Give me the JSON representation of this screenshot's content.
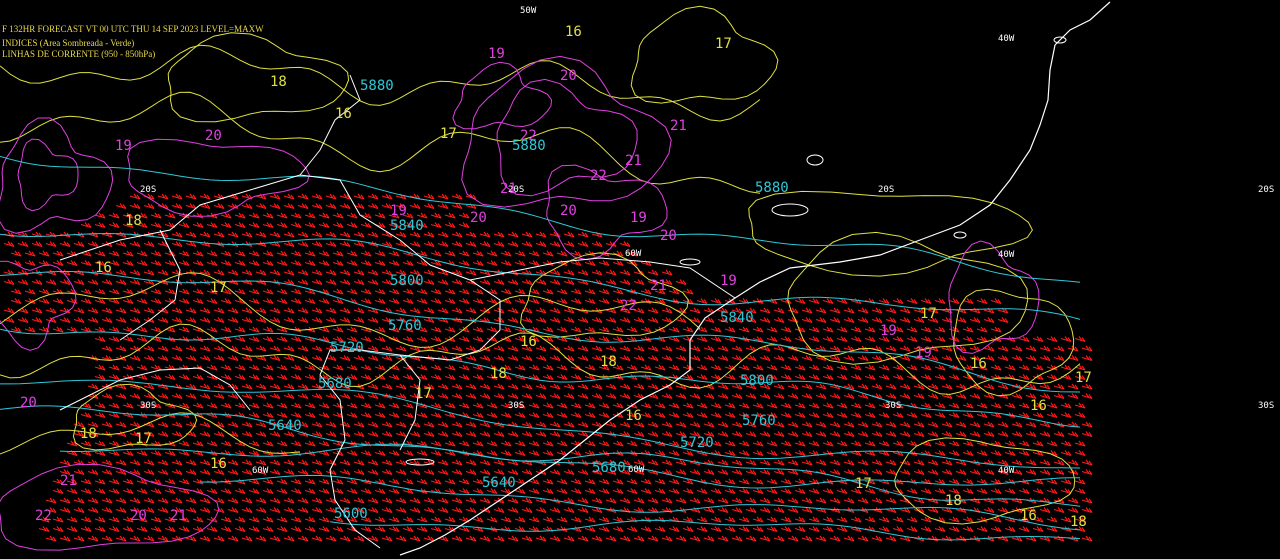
{
  "header": {
    "line1": "F 132HR FORECAST   VT 00 UTC THU 14 SEP 2023   LEVEL=MAXW",
    "line2": "INDICES (Area Sombreada - Verde)",
    "line3": "LINHAS DE CORRENTE (950 - 850hPa)"
  },
  "colors": {
    "background": "#000000",
    "wind_barbs": "#ff1a1a",
    "height_contours": "#2ec8d8",
    "index_contours_a": "#e0e040",
    "index_contours_b": "#e040e0",
    "coastline": "#ffffff",
    "grid_labels": "#ffffff"
  },
  "grid_labels": {
    "lat": [
      "20S",
      "20S",
      "20S",
      "20S",
      "30S",
      "30S",
      "30S",
      "30S"
    ],
    "lon": [
      "60W",
      "40W",
      "60W",
      "40W",
      "60W",
      "40W",
      "50W"
    ]
  },
  "height_labels": [
    "5880",
    "5880",
    "5840",
    "5800",
    "5760",
    "5720",
    "5680",
    "5640",
    "5840",
    "5800",
    "5760",
    "5720",
    "5680",
    "5640",
    "5600",
    "5880"
  ],
  "yellow_labels": [
    "16",
    "17",
    "18",
    "16",
    "17",
    "18",
    "16",
    "17",
    "16",
    "18",
    "17",
    "16",
    "18",
    "17",
    "16",
    "17",
    "18",
    "16",
    "17",
    "18",
    "16",
    "17",
    "16",
    "18"
  ],
  "magenta_labels": [
    "19",
    "20",
    "21",
    "22",
    "19",
    "20",
    "21",
    "22",
    "20",
    "19",
    "21",
    "20",
    "19",
    "20",
    "22",
    "21",
    "19",
    "19",
    "20",
    "21",
    "22",
    "20",
    "21",
    "19"
  ]
}
